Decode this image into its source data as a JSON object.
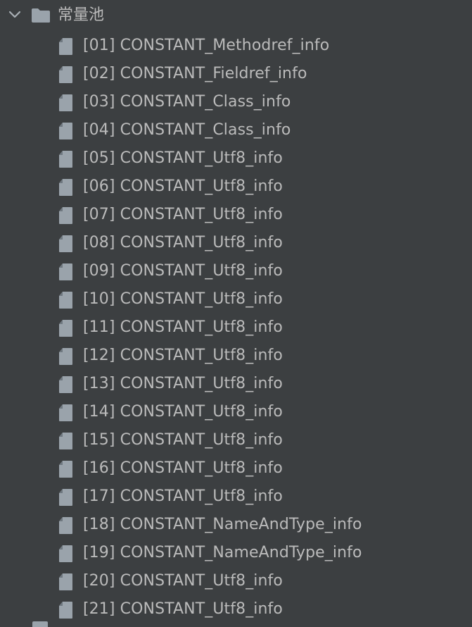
{
  "tree": {
    "root": {
      "label": "常量池",
      "icon": "folder-icon",
      "expand_icon": "chevron-down-icon",
      "expanded": true
    },
    "items": [
      {
        "label": "[01] CONSTANT_Methodref_info",
        "icon": "file-icon"
      },
      {
        "label": "[02] CONSTANT_Fieldref_info",
        "icon": "file-icon"
      },
      {
        "label": "[03] CONSTANT_Class_info",
        "icon": "file-icon"
      },
      {
        "label": "[04] CONSTANT_Class_info",
        "icon": "file-icon"
      },
      {
        "label": "[05] CONSTANT_Utf8_info",
        "icon": "file-icon"
      },
      {
        "label": "[06] CONSTANT_Utf8_info",
        "icon": "file-icon"
      },
      {
        "label": "[07] CONSTANT_Utf8_info",
        "icon": "file-icon"
      },
      {
        "label": "[08] CONSTANT_Utf8_info",
        "icon": "file-icon"
      },
      {
        "label": "[09] CONSTANT_Utf8_info",
        "icon": "file-icon"
      },
      {
        "label": "[10] CONSTANT_Utf8_info",
        "icon": "file-icon"
      },
      {
        "label": "[11] CONSTANT_Utf8_info",
        "icon": "file-icon"
      },
      {
        "label": "[12] CONSTANT_Utf8_info",
        "icon": "file-icon"
      },
      {
        "label": "[13] CONSTANT_Utf8_info",
        "icon": "file-icon"
      },
      {
        "label": "[14] CONSTANT_Utf8_info",
        "icon": "file-icon"
      },
      {
        "label": "[15] CONSTANT_Utf8_info",
        "icon": "file-icon"
      },
      {
        "label": "[16] CONSTANT_Utf8_info",
        "icon": "file-icon"
      },
      {
        "label": "[17] CONSTANT_Utf8_info",
        "icon": "file-icon"
      },
      {
        "label": "[18] CONSTANT_NameAndType_info",
        "icon": "file-icon"
      },
      {
        "label": "[19] CONSTANT_NameAndType_info",
        "icon": "file-icon"
      },
      {
        "label": "[20] CONSTANT_Utf8_info",
        "icon": "file-icon"
      },
      {
        "label": "[21] CONSTANT_Utf8_info",
        "icon": "file-icon"
      }
    ]
  },
  "colors": {
    "background": "#3c3f41",
    "text": "#bbbbbb",
    "icon": "#9aa3ab"
  }
}
